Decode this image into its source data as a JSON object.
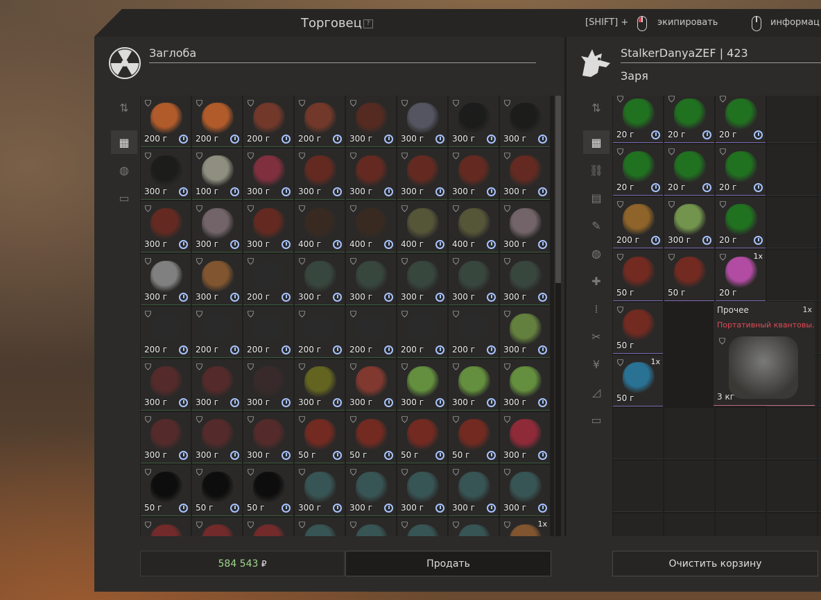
{
  "header": {
    "title": "Торговец",
    "help": "?",
    "hint_shift": "[SHIFT] +",
    "hint_equip": "экипировать",
    "hint_info": "информац"
  },
  "trader": {
    "name": "Заглоба"
  },
  "player": {
    "name": "StalkerDanyaZEF | 423",
    "faction": "Заря"
  },
  "trader_grid": [
    [
      "200 г",
      "200 г",
      "200 г",
      "200 г",
      "300 г",
      "300 г",
      "300 г",
      "300 г"
    ],
    [
      "300 г",
      "100 г",
      "300 г",
      "300 г",
      "300 г",
      "300 г",
      "300 г",
      "300 г"
    ],
    [
      "300 г",
      "300 г",
      "300 г",
      "400 г",
      "400 г",
      "400 г",
      "400 г",
      "300 г"
    ],
    [
      "300 г",
      "300 г",
      "200 г",
      "300 г",
      "300 г",
      "300 г",
      "300 г",
      "300 г"
    ],
    [
      "200 г",
      "200 г",
      "200 г",
      "200 г",
      "200 г",
      "200 г",
      "200 г",
      "300 г"
    ],
    [
      "300 г",
      "300 г",
      "300 г",
      "300 г",
      "300 г",
      "300 г",
      "300 г",
      "300 г"
    ],
    [
      "300 г",
      "300 г",
      "300 г",
      "50 г",
      "50 г",
      "50 г",
      "50 г",
      "300 г"
    ],
    [
      "50 г",
      "50 г",
      "50 г",
      "300 г",
      "300 г",
      "300 г",
      "300 г",
      "300 г"
    ],
    [
      "",
      "",
      "",
      "",
      "",
      "",
      "",
      "1x"
    ]
  ],
  "trader_colors": [
    [
      "#c0602a",
      "#c0602a",
      "#7a3a2a",
      "#7a3a2a",
      "#5a2a20",
      "#5a5a68",
      "#1a1a1a",
      "#1a1a1a"
    ],
    [
      "#1a1a1a",
      "#9a9a8a",
      "#8a3040",
      "#6a2a20",
      "#6a2a20",
      "#6a2a20",
      "#6a2a20",
      "#6a2a20"
    ],
    [
      "#6a2a20",
      "#7a6a70",
      "#6a2a20",
      "#3a2a20",
      "#3a2a20",
      "#5a5a3a",
      "#5a5a3a",
      "#7a6a70"
    ],
    [
      "#8a8a8a",
      "#8a5a30",
      "#2a2a2a",
      "#3a4a40",
      "#3a4a40",
      "#3a4a40",
      "#3a4a40",
      "#3a4a40"
    ],
    [
      "#2a2a2a",
      "#2a2a2a",
      "#2a2a2a",
      "#2a2a2a",
      "#2a2a2a",
      "#2a2a2a",
      "#2a2a2a",
      "#6a8a40"
    ],
    [
      "#5a2a2a",
      "#5a2a2a",
      "#3a2a2a",
      "#6a6a20",
      "#8a3a30",
      "#6a9a40",
      "#6a9a40",
      "#6a9a40"
    ],
    [
      "#5a2a2a",
      "#5a2a2a",
      "#5a2a2a",
      "#7a2a20",
      "#7a2a20",
      "#7a2a20",
      "#7a2a20",
      "#9a2a3a"
    ],
    [
      "#0a0a0a",
      "#0a0a0a",
      "#0a0a0a",
      "#3a5a5a",
      "#3a5a5a",
      "#3a5a5a",
      "#3a5a5a",
      "#3a5a5a"
    ],
    [
      "#7a2a2a",
      "#7a2a2a",
      "#7a2a2a",
      "#3a5a5a",
      "#3a5a5a",
      "#3a5a5a",
      "#3a5a5a",
      "#8a5a30"
    ]
  ],
  "player_grid": [
    [
      "20 г",
      "20 г",
      "20 г",
      "",
      ""
    ],
    [
      "20 г",
      "20 г",
      "20 г",
      "",
      ""
    ],
    [
      "200 г",
      "300 г",
      "20 г",
      "",
      ""
    ],
    [
      "50 г",
      "50 г",
      "20 г",
      "",
      ""
    ],
    [
      "50 г",
      "",
      "",
      "",
      ""
    ],
    [
      "50 г",
      "",
      "",
      "",
      ""
    ]
  ],
  "player_qty": {
    "3_2": "1x",
    "5_0": "1x"
  },
  "player_colors": [
    [
      "#1f7a1f",
      "#1f7a1f",
      "#1f7a1f"
    ],
    [
      "#1f7a1f",
      "#1f7a1f",
      "#1f7a1f"
    ],
    [
      "#9a6a2a",
      "#7aa050",
      "#1f7a1f"
    ],
    [
      "#7a2a20",
      "#7a2a20",
      "#c050b0"
    ],
    [
      "#7a2a20"
    ],
    [
      "#2a7aa0"
    ]
  ],
  "big_item": {
    "category": "Прочее",
    "qty": "1x",
    "name": "Портативный квантовы..",
    "weight": "3 кг"
  },
  "footer": {
    "money": "584 543",
    "currency": "₽",
    "sell": "Продать",
    "clear_cart": "Очистить корзину"
  }
}
